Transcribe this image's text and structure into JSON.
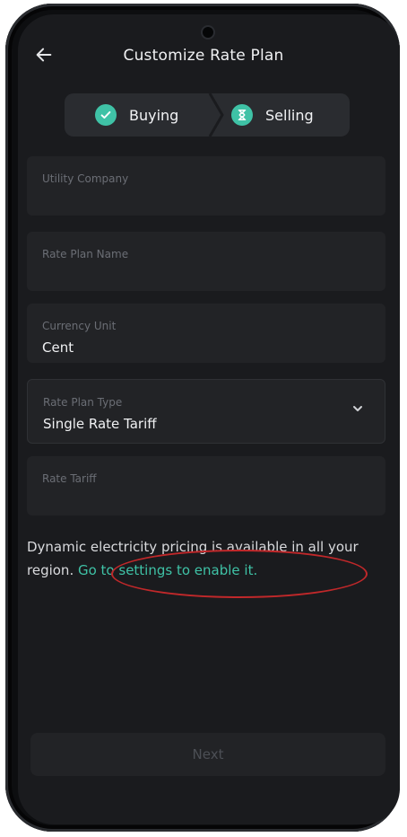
{
  "header": {
    "title": "Customize Rate Plan"
  },
  "stepper": {
    "steps": [
      {
        "label": "Buying",
        "icon": "check-icon"
      },
      {
        "label": "Selling",
        "icon": "hourglass-icon"
      }
    ]
  },
  "form": {
    "utility_company": {
      "label": "Utility Company",
      "value": ""
    },
    "rate_plan_name": {
      "label": "Rate Plan Name",
      "value": ""
    },
    "currency_unit": {
      "label": "Currency Unit",
      "value": "Cent"
    },
    "rate_plan_type": {
      "label": "Rate Plan Type",
      "value": "Single Rate Tariff"
    },
    "rate_tariff": {
      "label": "Rate Tariff",
      "value": ""
    }
  },
  "notice": {
    "text": "Dynamic electricity pricing is available in all your region. ",
    "link": "Go to settings to enable it."
  },
  "footer": {
    "next_label": "Next"
  },
  "colors": {
    "accent": "#3fc2a6",
    "background": "#1a1b1e",
    "field": "#222326",
    "annotation": "#c0282a"
  }
}
